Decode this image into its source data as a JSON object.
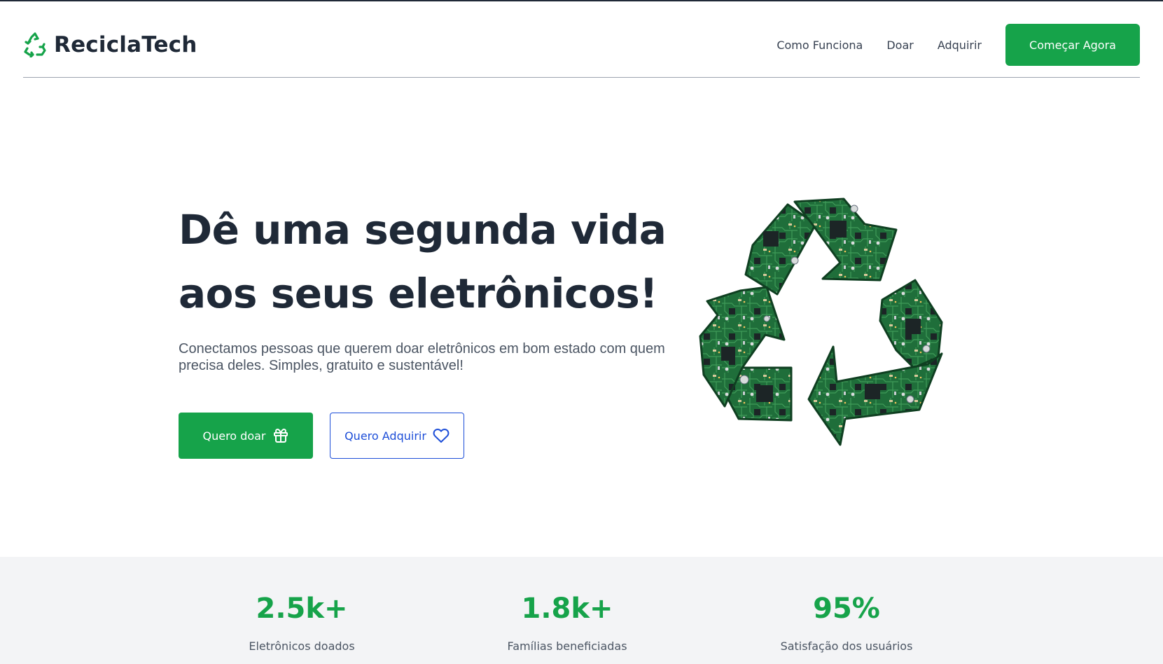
{
  "brand": {
    "name": "ReciclaTech",
    "icon": "recycle-icon",
    "color": "#16a34a"
  },
  "nav": {
    "links": [
      "Como Funciona",
      "Doar",
      "Adquirir"
    ],
    "cta": "Começar Agora"
  },
  "hero": {
    "title_line1": "Dê uma segunda vida",
    "title_line2": "aos seus eletrônicos!",
    "subtitle": "Conectamos pessoas que querem doar eletrônicos em bom estado com quem precisa deles. Simples, gratuito e sustentável!",
    "donate_button": "Quero doar",
    "donate_icon": "gift-icon",
    "acquire_button": "Quero Adquirir",
    "acquire_icon": "heart-icon",
    "image": "recycle-circuit-board-illustration"
  },
  "stats": [
    {
      "value": "2.5k+",
      "label": "Eletrônicos doados"
    },
    {
      "value": "1.8k+",
      "label": "Famílias beneficiadas"
    },
    {
      "value": "95%",
      "label": "Satisfação dos usuários"
    }
  ],
  "colors": {
    "primary": "#16a34a",
    "secondary": "#1d4ed8",
    "text": "#1f2937",
    "muted": "#4b5563",
    "stats_bg": "#f3f4f6"
  }
}
